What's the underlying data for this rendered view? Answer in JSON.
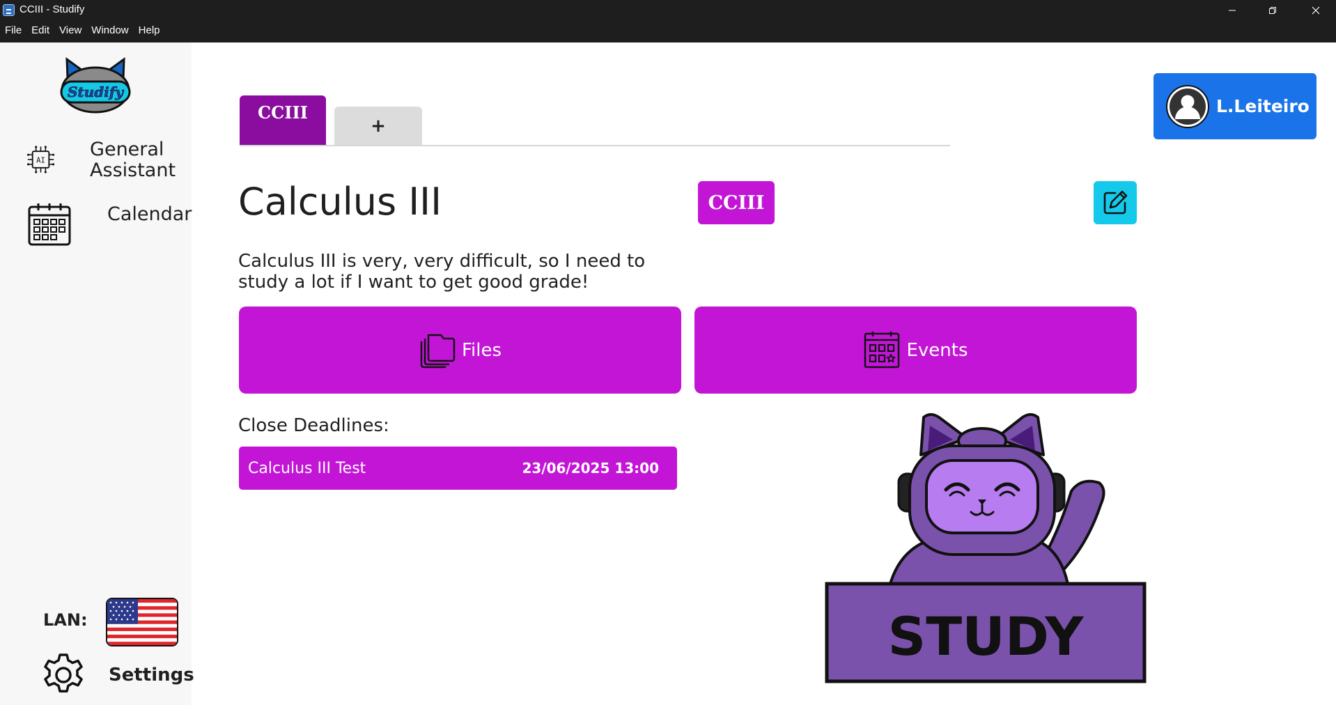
{
  "window": {
    "title": "CCIII - Studify",
    "menu": [
      "File",
      "Edit",
      "View",
      "Window",
      "Help"
    ]
  },
  "sidebar": {
    "logo_text": "Studify",
    "items": [
      {
        "label": "General Assistant",
        "icon": "ai-chip-icon"
      },
      {
        "label": "Calendar",
        "icon": "calendar-icon"
      }
    ],
    "language_label": "LAN:",
    "language_flag": "us-flag-icon",
    "settings_label": "Settings"
  },
  "tabs": {
    "active": "CCIII",
    "add": "+"
  },
  "subject": {
    "title": "Calculus III",
    "code": "CCIII",
    "description": "Calculus III is very, very difficult, so I need to study a lot if I want to get good grade!"
  },
  "actions": {
    "files_label": "Files",
    "events_label": "Events"
  },
  "deadlines": {
    "label": "Close Deadlines:",
    "items": [
      {
        "name": "Calculus III Test",
        "date": "23/06/2025 13:00"
      }
    ]
  },
  "user": {
    "name": "L.Leiteiro"
  },
  "mascot": {
    "sign_text": "STUDY"
  },
  "colors": {
    "accent": "#c315d6",
    "active_tab": "#8b0d9f",
    "user_button": "#1a73e8",
    "edit_button": "#15c9ea",
    "mascot": "#7b52ab"
  }
}
